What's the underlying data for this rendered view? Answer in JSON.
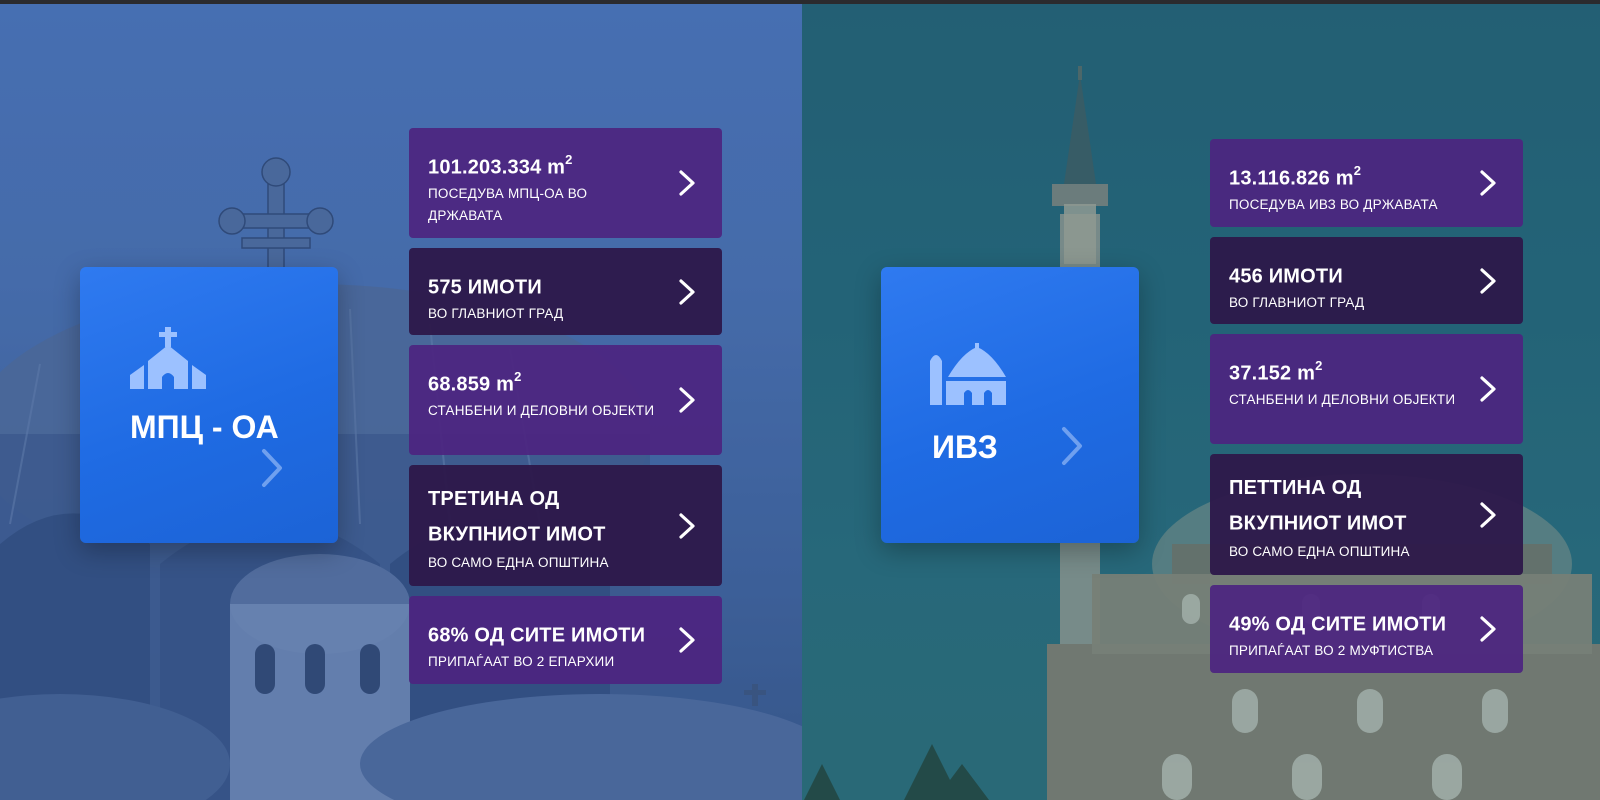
{
  "colors": {
    "hero_card": "#2f7af0",
    "stat_light": "#4c2580",
    "stat_dark": "#2d184a",
    "hero_icon": "#9cc1ff",
    "text": "#ffffff"
  },
  "left": {
    "title": "МПЦ - ОА",
    "icon": "church-icon",
    "stats": [
      {
        "value": "101.203.334 m",
        "sup": "2",
        "desc": "ПОСЕДУВА МПЦ-ОА ВО ДРЖАВАТА"
      },
      {
        "value": "575 ИМОТИ",
        "sup": "",
        "desc": "ВО ГЛАВНИОТ ГРАД"
      },
      {
        "value": "68.859 m",
        "sup": "2",
        "desc": "СТАНБЕНИ И ДЕЛОВНИ ОБЈЕКТИ"
      },
      {
        "value": "ТРЕТИНА ОД ВКУПНИОТ ИМОТ",
        "sup": "",
        "desc": "ВО САМО ЕДНА ОПШТИНА"
      },
      {
        "value": "68% ОД СИТЕ ИМОТИ",
        "sup": "",
        "desc": "ПРИПАЃААТ ВО 2 ЕПАРХИИ"
      }
    ]
  },
  "right": {
    "title": "ИВЗ",
    "icon": "mosque-icon",
    "stats": [
      {
        "value": "13.116.826 m",
        "sup": "2",
        "desc": "ПОСЕДУВА ИВЗ ВО ДРЖАВАТА"
      },
      {
        "value": "456 ИМОТИ",
        "sup": "",
        "desc": "ВО ГЛАВНИОТ ГРАД"
      },
      {
        "value": "37.152 m",
        "sup": "2",
        "desc": "СТАНБЕНИ И ДЕЛОВНИ ОБЈЕКТИ"
      },
      {
        "value": "ПЕТТИНА ОД ВКУПНИОТ ИМОТ",
        "sup": "",
        "desc": "ВО САМО ЕДНА ОПШТИНА"
      },
      {
        "value": "49% ОД СИТЕ ИМОТИ",
        "sup": "",
        "desc": "ПРИПАЃААТ ВО 2 МУФТИСТВА"
      }
    ]
  }
}
